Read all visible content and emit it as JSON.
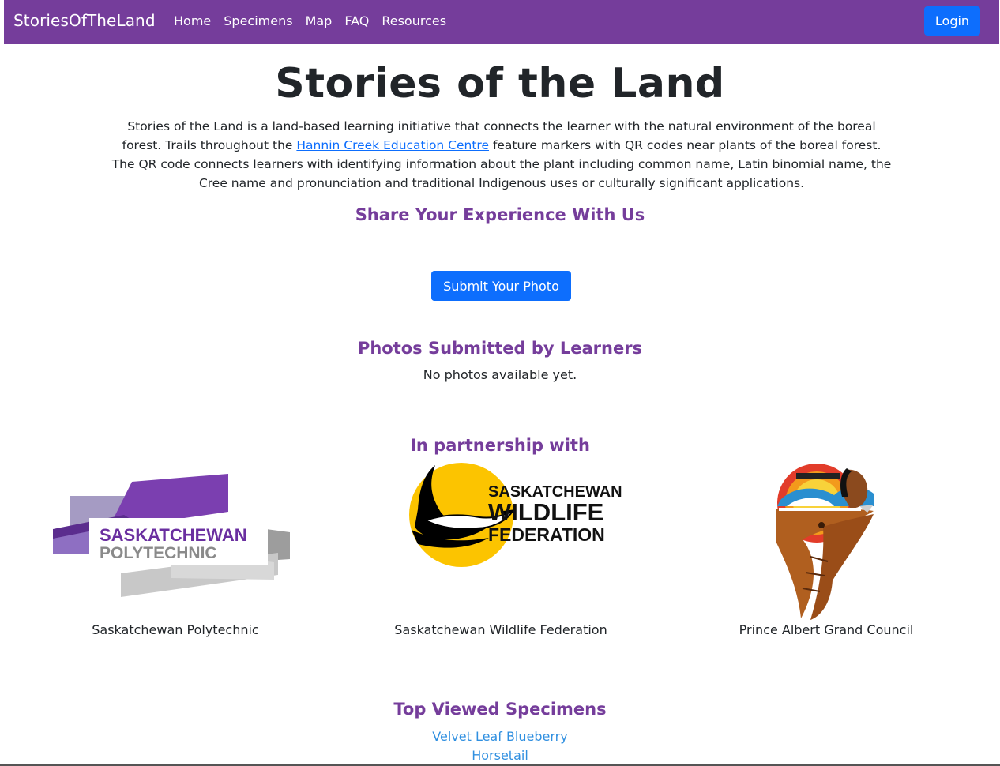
{
  "navbar": {
    "brand": "StoriesOfTheLand",
    "links": [
      "Home",
      "Specimens",
      "Map",
      "FAQ",
      "Resources"
    ],
    "login_label": "Login",
    "bg_color": "#753d9b"
  },
  "hero": {
    "title": "Stories of the Land",
    "intro_before_link": "Stories of the Land is a land-based learning initiative that connects the learner with the natural environment of the boreal forest. Trails throughout the ",
    "intro_link": "Hannin Creek Education Centre",
    "intro_after_link": " feature markers with QR codes near plants of the boreal forest. The QR code connects learners with identifying information about the plant including common name, Latin binomial name, the Cree name and pronunciation and traditional Indigenous uses or culturally significant applications."
  },
  "share": {
    "heading": "Share Your Experience With Us",
    "button_label": "Submit Your Photo"
  },
  "photos": {
    "heading": "Photos Submitted by Learners",
    "empty_text": "No photos available yet."
  },
  "partners": {
    "heading": "In partnership with",
    "items": [
      {
        "name": "Saskatchewan Polytechnic",
        "logo_text_1": "SASKATCHEWAN",
        "logo_text_2": "POLYTECHNIC"
      },
      {
        "name": "Saskatchewan Wildlife Federation",
        "logo_text_1": "SASKATCHEWAN",
        "logo_text_2": "WILDLIFE",
        "logo_text_3": "FEDERATION"
      },
      {
        "name": "Prince Albert Grand Council"
      }
    ]
  },
  "top_specimens": {
    "heading": "Top Viewed Specimens",
    "items": [
      "Velvet Leaf Blueberry",
      "Horsetail"
    ]
  },
  "colors": {
    "accent_purple": "#753d9b",
    "primary_blue": "#0d6efd",
    "link_blue": "#2f8fe0"
  }
}
